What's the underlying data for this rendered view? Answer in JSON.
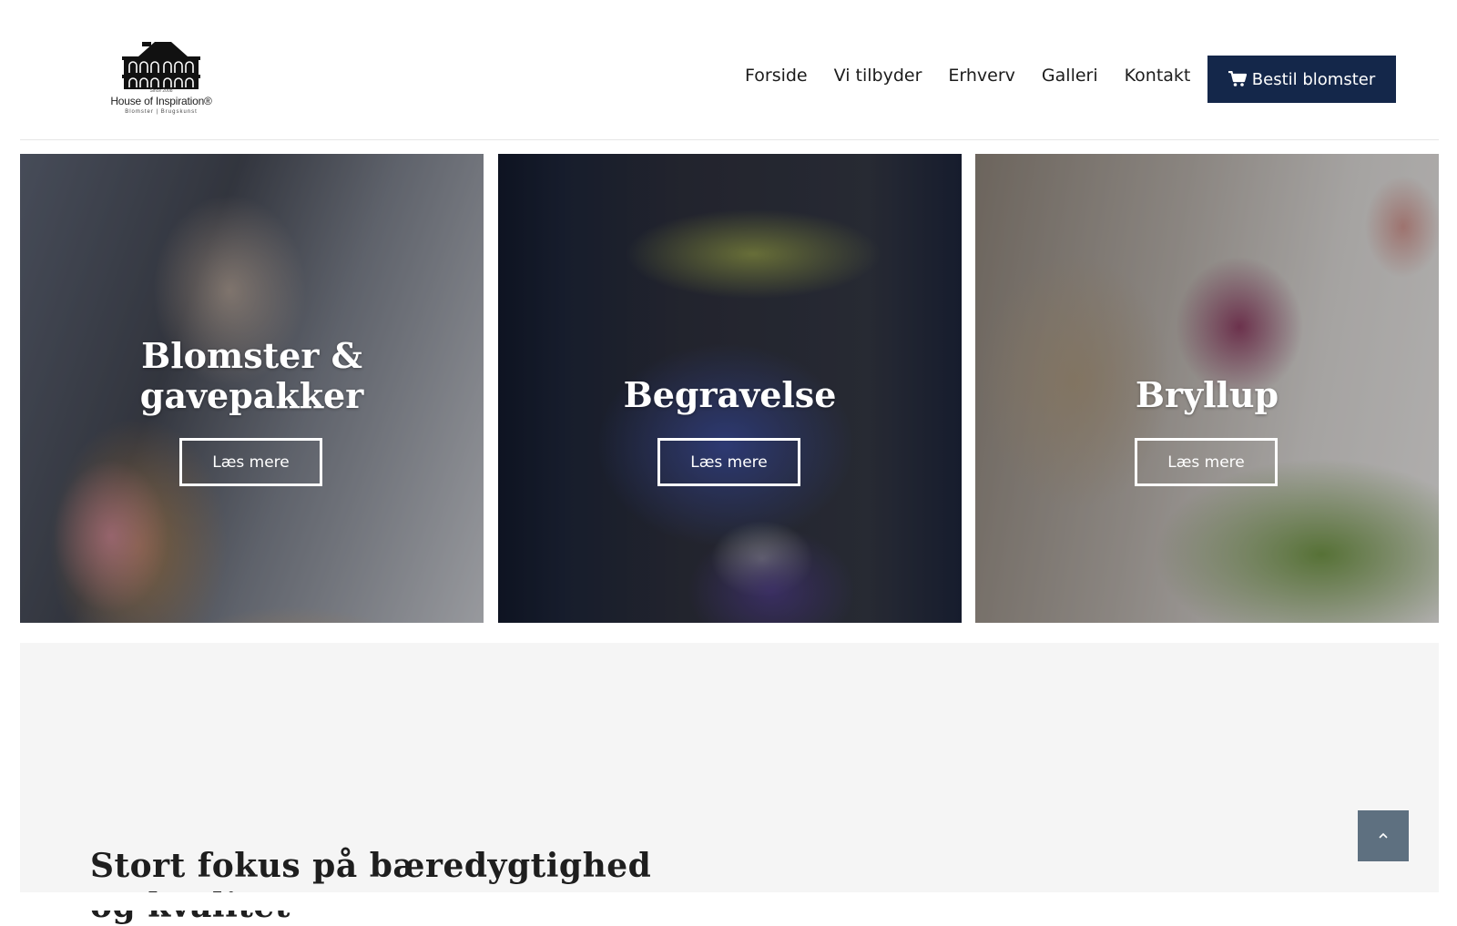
{
  "header": {
    "logo": {
      "name": "House of Inspiration®",
      "since": "Since 2008",
      "tagline": "Blomster | Brugskunst",
      "icon": "house-logo-icon"
    },
    "nav": [
      "Forside",
      "Vi tilbyder",
      "Erhverv",
      "Galleri",
      "Kontakt"
    ],
    "order_button": {
      "label": "Bestil blomster",
      "icon": "shopping-cart-icon"
    }
  },
  "tiles": [
    {
      "title": "Blomster & gavepakker",
      "button": "Læs mere"
    },
    {
      "title": "Begravelse",
      "button": "Læs mere"
    },
    {
      "title": "Bryllup",
      "button": "Læs mere"
    }
  ],
  "feature": {
    "heading": "Stort fokus på bæredygtighed og kvalitet"
  },
  "scroll_top": {
    "icon": "chevron-up-icon"
  },
  "colors": {
    "primary": "#14274a",
    "scroll_button": "#5e7080",
    "section_bg": "#f5f5f5"
  }
}
